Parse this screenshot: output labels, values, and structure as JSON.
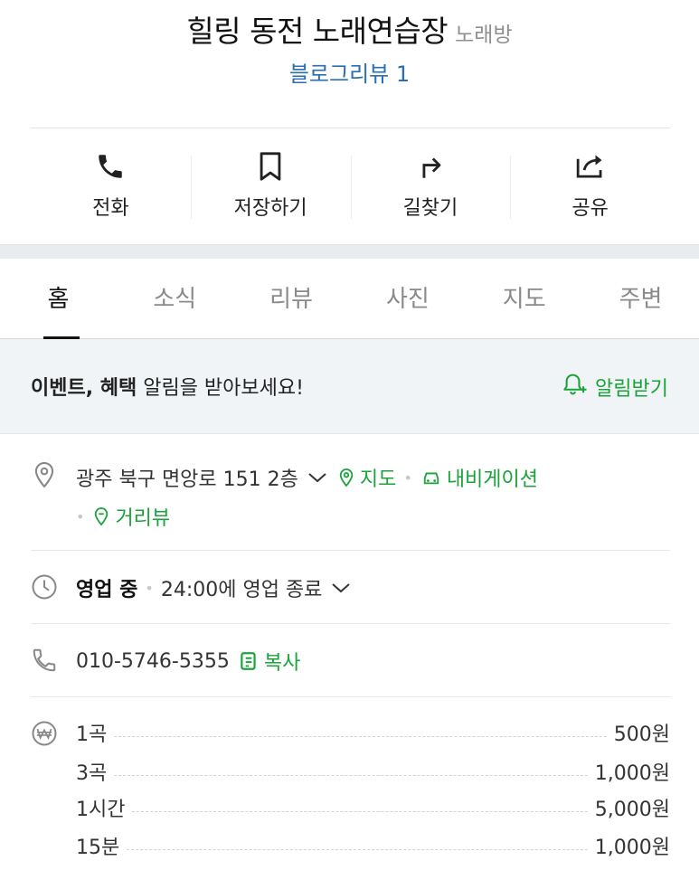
{
  "place": {
    "title": "힐링 동전 노래연습장",
    "category": "노래방",
    "blog_review": "블로그리뷰 1"
  },
  "actions": [
    {
      "label": "전화",
      "icon": "phone-icon"
    },
    {
      "label": "저장하기",
      "icon": "bookmark-icon"
    },
    {
      "label": "길찾기",
      "icon": "directions-icon"
    },
    {
      "label": "공유",
      "icon": "share-icon"
    }
  ],
  "tabs": [
    {
      "label": "홈",
      "active": true
    },
    {
      "label": "소식",
      "active": false
    },
    {
      "label": "리뷰",
      "active": false
    },
    {
      "label": "사진",
      "active": false
    },
    {
      "label": "지도",
      "active": false
    },
    {
      "label": "주변",
      "active": false
    }
  ],
  "banner": {
    "bold_text": "이벤트, 혜택",
    "text": " 알림을 받아보세요!",
    "button": "알림받기"
  },
  "address": {
    "text": "광주 북구 면앙로 151 2층",
    "map": "지도",
    "navigation": "내비게이션",
    "street_view": "거리뷰"
  },
  "hours": {
    "status": "영업 중",
    "detail": "24:00에 영업 종료"
  },
  "phone": {
    "number": "010-5746-5355",
    "copy": "복사"
  },
  "prices": [
    {
      "label": "1곡",
      "value": "500원"
    },
    {
      "label": "3곡",
      "value": "1,000원"
    },
    {
      "label": "1시간",
      "value": "5,000원"
    },
    {
      "label": "15분",
      "value": "1,000원"
    }
  ],
  "colors": {
    "accent_green": "#1aa33a",
    "link_blue": "#2a6fb3",
    "banner_bg": "#f1f4f6"
  }
}
